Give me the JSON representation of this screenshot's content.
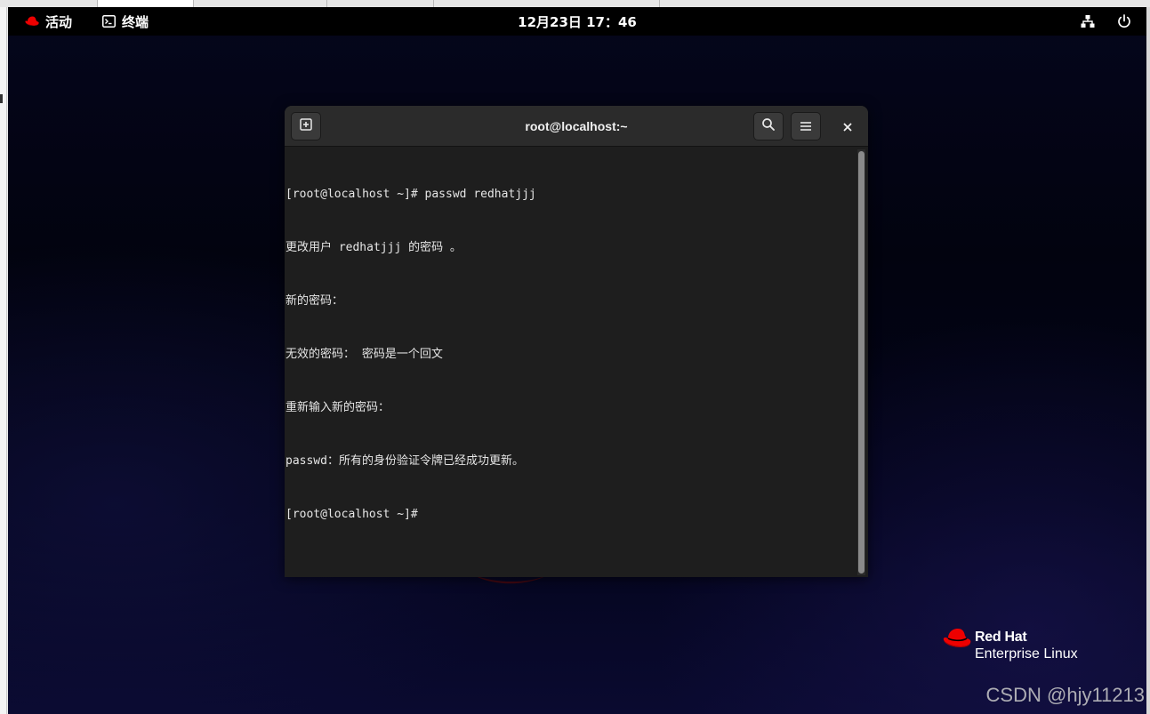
{
  "topbar": {
    "activities_label": "活动",
    "app_label": "终端",
    "clock": "12月23日 17：46",
    "icons": [
      "redhat-icon",
      "terminal-icon",
      "network-icon",
      "power-icon"
    ]
  },
  "terminal": {
    "title": "root@localhost:~",
    "lines": [
      "[root@localhost ~]# passwd redhatjjj",
      "更改用户 redhatjjj 的密码 。",
      "新的密码：",
      "无效的密码： 密码是一个回文",
      "重新输入新的密码：",
      "passwd：所有的身份验证令牌已经成功更新。",
      "[root@localhost ~]#"
    ]
  },
  "brand": {
    "name": "Red Hat",
    "product": "Enterprise Linux"
  },
  "watermark": "CSDN @hjy11213",
  "colors": {
    "accent_red": "#ee0000",
    "terminal_bg": "#1e1e1e",
    "header_bg": "#2b2b2b",
    "topbar_bg": "#000000"
  }
}
